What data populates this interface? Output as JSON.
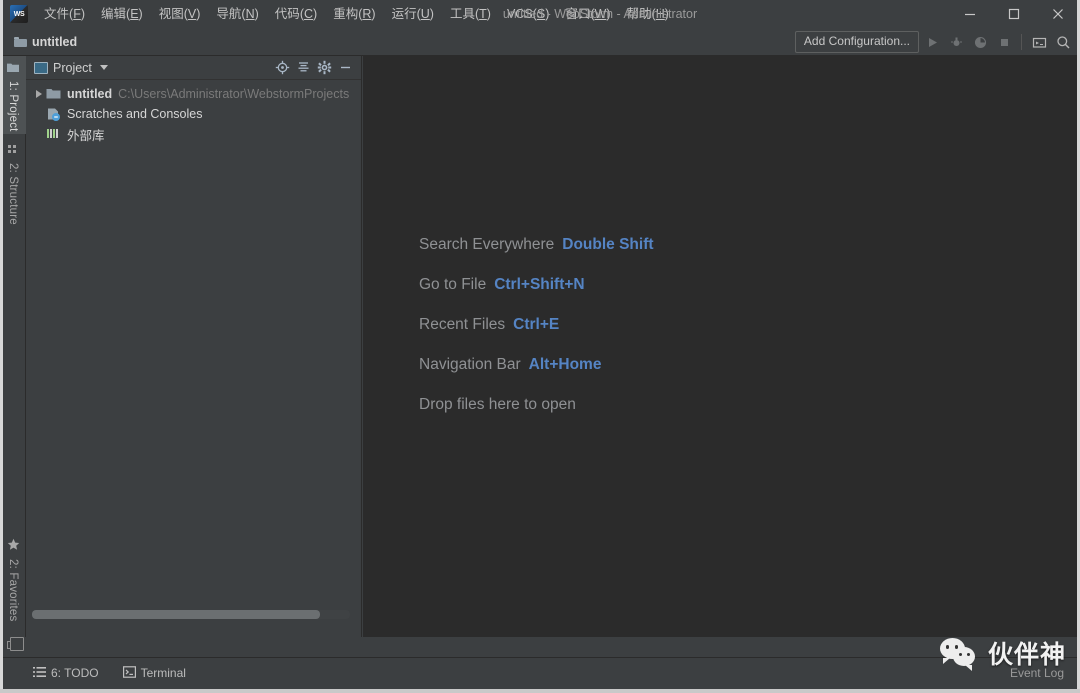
{
  "window": {
    "title": "untitled - WebStorm - Administrator",
    "logo_text": "WS",
    "minimize_label": "Minimize",
    "maximize_label": "Maximize",
    "close_label": "Close"
  },
  "menubar": {
    "items": [
      {
        "label": "文件",
        "mnemonic": "F"
      },
      {
        "label": "编辑",
        "mnemonic": "E"
      },
      {
        "label": "视图",
        "mnemonic": "V"
      },
      {
        "label": "导航",
        "mnemonic": "N"
      },
      {
        "label": "代码",
        "mnemonic": "C"
      },
      {
        "label": "重构",
        "mnemonic": "R"
      },
      {
        "label": "运行",
        "mnemonic": "U"
      },
      {
        "label": "工具",
        "mnemonic": "T"
      },
      {
        "label": "VCS",
        "mnemonic": "S"
      },
      {
        "label": "窗口",
        "mnemonic": "W"
      },
      {
        "label": "帮助",
        "mnemonic": "H"
      }
    ]
  },
  "navbar": {
    "breadcrumb": "untitled",
    "add_configuration": "Add Configuration...",
    "icons": [
      {
        "name": "run-icon",
        "enabled": false
      },
      {
        "name": "debug-icon",
        "enabled": false
      },
      {
        "name": "run-with-coverage-icon",
        "enabled": false
      },
      {
        "name": "stop-icon",
        "enabled": false
      },
      {
        "name": "hide-window-icon",
        "enabled": true
      },
      {
        "name": "search-icon",
        "enabled": true
      }
    ]
  },
  "left_tool_bar": {
    "top_tabs": [
      {
        "label": "1: Project",
        "icon": "project-folder-icon",
        "active": true
      },
      {
        "label": "2: Structure",
        "icon": "structure-icon",
        "active": false
      }
    ],
    "bottom_tabs": [
      {
        "label": "2: Favorites",
        "icon": "star-icon",
        "active": false
      }
    ]
  },
  "project_panel": {
    "title": "Project",
    "actions": [
      {
        "name": "locate-target-icon",
        "label": "Select Opened File"
      },
      {
        "name": "collapse-all-icon",
        "label": "Collapse All"
      },
      {
        "name": "gear-icon",
        "label": "Settings"
      },
      {
        "name": "hide-icon",
        "label": "Hide"
      }
    ],
    "tree": [
      {
        "label": "untitled",
        "sub": "C:\\Users\\Administrator\\WebstormProjects",
        "icon": "folder-icon",
        "expandable": true,
        "expanded": false,
        "indent": 0,
        "bold": true
      },
      {
        "label": "Scratches and Consoles",
        "sub": "",
        "icon": "scratches-icon",
        "expandable": false,
        "expanded": false,
        "indent": 1,
        "bold": false
      },
      {
        "label": "外部库",
        "sub": "",
        "icon": "external-libraries-icon",
        "expandable": false,
        "expanded": false,
        "indent": 1,
        "bold": false
      }
    ]
  },
  "editor": {
    "tips": [
      {
        "action": "Search Everywhere",
        "shortcut": "Double Shift"
      },
      {
        "action": "Go to File",
        "shortcut": "Ctrl+Shift+N"
      },
      {
        "action": "Recent Files",
        "shortcut": "Ctrl+E"
      },
      {
        "action": "Navigation Bar",
        "shortcut": "Alt+Home"
      },
      {
        "action": "Drop files here to open",
        "shortcut": ""
      }
    ]
  },
  "statusbar": {
    "items": [
      {
        "label": "6: TODO",
        "mnemonic": "6",
        "icon": "todo-list-icon"
      },
      {
        "label": "Terminal",
        "mnemonic": "",
        "icon": "terminal-icon"
      }
    ],
    "right_label": "Event Log"
  },
  "watermark": {
    "text": "伙伴神",
    "icon": "wechat-icon"
  },
  "colors": {
    "editor_background": "#2b2b2b",
    "panel_background": "#3c3f41",
    "accent_link": "#5584c4",
    "text_primary": "#bbbbbb",
    "text_dim": "#7a7a7a"
  }
}
